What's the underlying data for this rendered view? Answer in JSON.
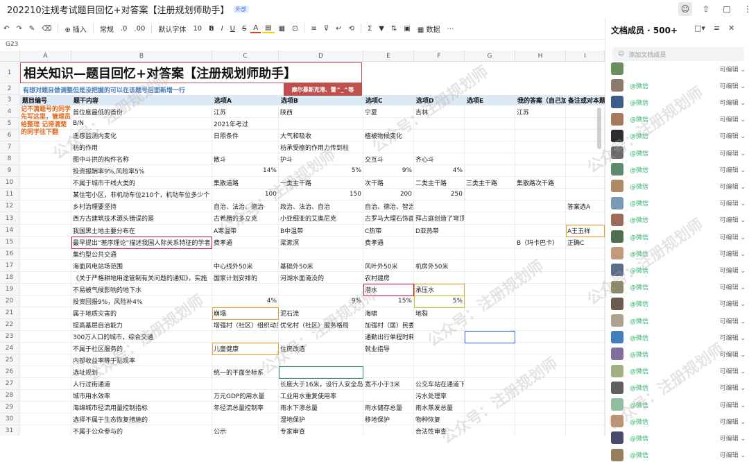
{
  "doc_title": "202210注规考试题目回忆+对答案【注册规划师助手】",
  "doc_badge": "外部",
  "toolbar": {
    "insert": "插入",
    "format": "常规",
    "font": "默认字体",
    "size": "10",
    "bold": "B",
    "italic": "I",
    "underline": "U",
    "strike": "S",
    "data": "数据"
  },
  "cell_ref": "G23",
  "columns": [
    "A",
    "B",
    "C",
    "D",
    "E",
    "F",
    "G",
    "H",
    "I"
  ],
  "title": "相关知识—题目回忆+对答案【注册规划师助手】",
  "subtitle": "有想对题目做调整但是没把握的可以在该题号后面新增一行",
  "red_band": "摩尔曼斯克港、蕾^_^等",
  "headers": [
    "题目编号",
    "题干内容",
    "选项A",
    "选项B",
    "选项C",
    "选项D",
    "选项E",
    "我的答案（自己加",
    ""
  ],
  "header_i": "备注或对本题",
  "note": "记不清题号的同学先写这里，管理员给整理 记得清楚的同学往下翻",
  "rows": [
    {
      "n": "4",
      "b": "首位度最低的首份",
      "c": "江苏",
      "d": "陕西",
      "e": "宁夏",
      "f": "吉林",
      "g": "",
      "h": "江苏",
      "i": ""
    },
    {
      "n": "5",
      "b": "B/N",
      "c": "2021年考过",
      "d": "",
      "e": "",
      "f": "",
      "g": "",
      "h": "",
      "i": ""
    },
    {
      "n": "6",
      "b": "遥感监测内变化",
      "c": "日照条件",
      "d": "大气和吸收",
      "e": "植被物候变化",
      "f": "",
      "g": "",
      "h": "",
      "i": ""
    },
    {
      "n": "7",
      "b": "枋的作用",
      "c": "",
      "d": "枋承受檩的作用力传到柱",
      "e": "",
      "f": "",
      "g": "",
      "h": "",
      "i": ""
    },
    {
      "n": "8",
      "b": "图中斗拱的构件名称",
      "c": "散斗",
      "d": "护斗",
      "e": "交互斗",
      "f": "齐心斗",
      "g": "",
      "h": "",
      "i": ""
    },
    {
      "n": "9",
      "b": "投资报酬率9%,风险率5%",
      "c": "14%",
      "d": "5%",
      "e": "9%",
      "f": "4%",
      "g": "",
      "h": "",
      "i": ""
    },
    {
      "n": "10",
      "b": "不属于城市干线大类的",
      "c": "集散道路",
      "d": "一类主干路",
      "e": "次干路",
      "f": "二类主干路",
      "g": "三类主干路",
      "h": "集散路次干路",
      "i": ""
    },
    {
      "n": "11",
      "b": "某住宅小区，非机动车位210个，机动车位多少个",
      "c": "100",
      "d": "150",
      "e": "200",
      "f": "250",
      "g": "",
      "h": "",
      "i": ""
    },
    {
      "n": "12",
      "b": "乡村治理要坚持",
      "c": "自治、法治、德治",
      "d": "政治、法治、自治",
      "e": "自治、德治、智治",
      "f": "",
      "g": "",
      "h": "",
      "i": "答案选A"
    },
    {
      "n": "13",
      "b": "西方古建筑技术源头错误的是",
      "c": "古希腊的多立克",
      "d": "小亚细亚的艾奥尼克",
      "e": "古罗马大理石饰面",
      "f": "拜占庭创造了穹顶支在四个柱子上",
      "g": "",
      "h": "",
      "i": ""
    },
    {
      "n": "14",
      "b": "我国黑土地主要分布在",
      "c": "A寒温带",
      "d": "B中温带",
      "e": "C热带",
      "f": "D亚热带",
      "g": "",
      "h": "",
      "i": "A王玉祥"
    },
    {
      "n": "15",
      "b": "最早提出“差序理论”描述我国人际关系特征的学者",
      "c": "费孝通",
      "d": "梁漱溟",
      "e": "费孝通",
      "f": "",
      "g": "",
      "h": "B（玛卡巴卡）",
      "i": "正确C"
    },
    {
      "n": "16",
      "b": "集约型公共交通",
      "c": "",
      "d": "",
      "e": "",
      "f": "",
      "g": "",
      "h": "",
      "i": ""
    },
    {
      "n": "17",
      "b": "海面风电站场范围",
      "c": "中心线外50米",
      "d": "基础外50米",
      "e": "风叶外50米",
      "f": "机房外50米",
      "g": "",
      "h": "",
      "i": ""
    },
    {
      "n": "18",
      "b": "《关于严格耕地用途管制有关问题的通知》，实施",
      "c": "国家计划安排的",
      "d": "河湖水面淹没的",
      "e": "农村建房",
      "f": "",
      "g": "",
      "h": "",
      "i": ""
    },
    {
      "n": "19",
      "b": "不易被气候影响的地下水",
      "c": "",
      "d": "",
      "e": "潜水",
      "f": "承压水",
      "g": "",
      "h": "",
      "i": ""
    },
    {
      "n": "20",
      "b": "投资回报9%，风险补4%",
      "c": "4%",
      "d": "9%",
      "e": "15%",
      "f": "5%",
      "g": "",
      "h": "",
      "i": ""
    },
    {
      "n": "21",
      "b": "属于地质灾害的",
      "c": "崩塌",
      "d": "泥石流",
      "e": "海啸",
      "f": "地裂",
      "g": "",
      "h": "",
      "i": ""
    },
    {
      "n": "22",
      "b": "提高基层自治能力",
      "c": "增强村（社区）组织动员",
      "d": "优化村（社区）服务格局",
      "e": "加强村（居）民委员会规范化建设",
      "f": "",
      "g": "",
      "h": "",
      "i": ""
    },
    {
      "n": "23",
      "b": "300万人口的城市，综合交通",
      "c": "",
      "d": "",
      "e": "通勤出行单程时耗60分钟",
      "f": "",
      "g": "",
      "h": "",
      "i": ""
    },
    {
      "n": "24",
      "b": "不属于社区服务的",
      "c": "儿童健康",
      "d": "住房改造",
      "e": "就业指导",
      "f": "",
      "g": "",
      "h": "",
      "i": ""
    },
    {
      "n": "25",
      "b": "内部收益率等于贴现率",
      "c": "",
      "d": "",
      "e": "",
      "f": "",
      "g": "",
      "h": "",
      "i": ""
    },
    {
      "n": "26",
      "b": "选址规划",
      "c": "统一的平面坐标系",
      "d": "",
      "e": "",
      "f": "",
      "g": "",
      "h": "",
      "i": ""
    },
    {
      "n": "27",
      "b": "人行过街通道",
      "c": "",
      "d": "长度大于16米，设行人安全岛",
      "e": "宽不小于3米",
      "f": "公交车站在通道下游",
      "g": "",
      "h": "",
      "i": ""
    },
    {
      "n": "28",
      "b": "城市用水效率",
      "c": "万元GDP的用水量",
      "d": "工业用水重复使用率",
      "e": "",
      "f": "污水处理率",
      "g": "",
      "h": "",
      "i": ""
    },
    {
      "n": "29",
      "b": "海绵城市径流用量控制指标",
      "c": "年径流总量控制率",
      "d": "雨水下渗总量",
      "e": "雨水储存总量",
      "f": "雨水蒸发总量",
      "g": "",
      "h": "",
      "i": ""
    },
    {
      "n": "30",
      "b": "选择不属于生态恢复措施的",
      "c": "",
      "d": "湿地保护",
      "e": "移地保护",
      "f": "物种恢复",
      "g": "",
      "h": "",
      "i": ""
    },
    {
      "n": "31",
      "b": "不属于公众参与的",
      "c": "公示",
      "d": "专家审查",
      "e": "",
      "f": "合法性审查",
      "g": "",
      "h": "",
      "i": ""
    }
  ],
  "panel": {
    "title": "文档成员 · 500+",
    "search_placeholder": "添加文档成员",
    "wechat": "@微信",
    "permission": "可编辑",
    "members": [
      {
        "name": "",
        "wechat": false,
        "color": "#6a8f5e"
      },
      {
        "name": "",
        "wechat": true,
        "color": "#8d7a6a"
      },
      {
        "name": "",
        "wechat": true,
        "color": "#3a5f8a"
      },
      {
        "name": "",
        "wechat": true,
        "color": "#a67a5b"
      },
      {
        "name": "",
        "wechat": true,
        "color": "#2d2d2d"
      },
      {
        "name": "",
        "wechat": true,
        "color": "#6b6b6b"
      },
      {
        "name": "",
        "wechat": true,
        "color": "#5b8c6e"
      },
      {
        "name": "",
        "wechat": true,
        "color": "#b08a63"
      },
      {
        "name": "",
        "wechat": true,
        "color": "#7a9ab8"
      },
      {
        "name": "",
        "wechat": true,
        "color": "#9c6b5a"
      },
      {
        "name": "",
        "wechat": true,
        "color": "#4f6f4f"
      },
      {
        "name": "",
        "wechat": true,
        "color": "#c49a7a"
      },
      {
        "name": "",
        "wechat": true,
        "color": "#5a6b8c"
      },
      {
        "name": "",
        "wechat": true,
        "color": "#8a8a6a"
      },
      {
        "name": "",
        "wechat": true,
        "color": "#6d5a4e"
      },
      {
        "name": "",
        "wechat": true,
        "color": "#b0a090"
      },
      {
        "name": "",
        "wechat": true,
        "color": "#3f7fbf"
      },
      {
        "name": "",
        "wechat": true,
        "color": "#7f6f9f"
      },
      {
        "name": "",
        "wechat": true,
        "color": "#a0b080"
      },
      {
        "name": "",
        "wechat": true,
        "color": "#5f5f5f"
      },
      {
        "name": "",
        "wechat": true,
        "color": "#8fbfa0"
      },
      {
        "name": "",
        "wechat": true,
        "color": "#bf8f6f"
      },
      {
        "name": "",
        "wechat": true,
        "color": "#4a4a6a"
      },
      {
        "name": "",
        "wechat": true,
        "color": "#9a7f5f"
      }
    ]
  },
  "watermark": "公众号：注册规划师"
}
